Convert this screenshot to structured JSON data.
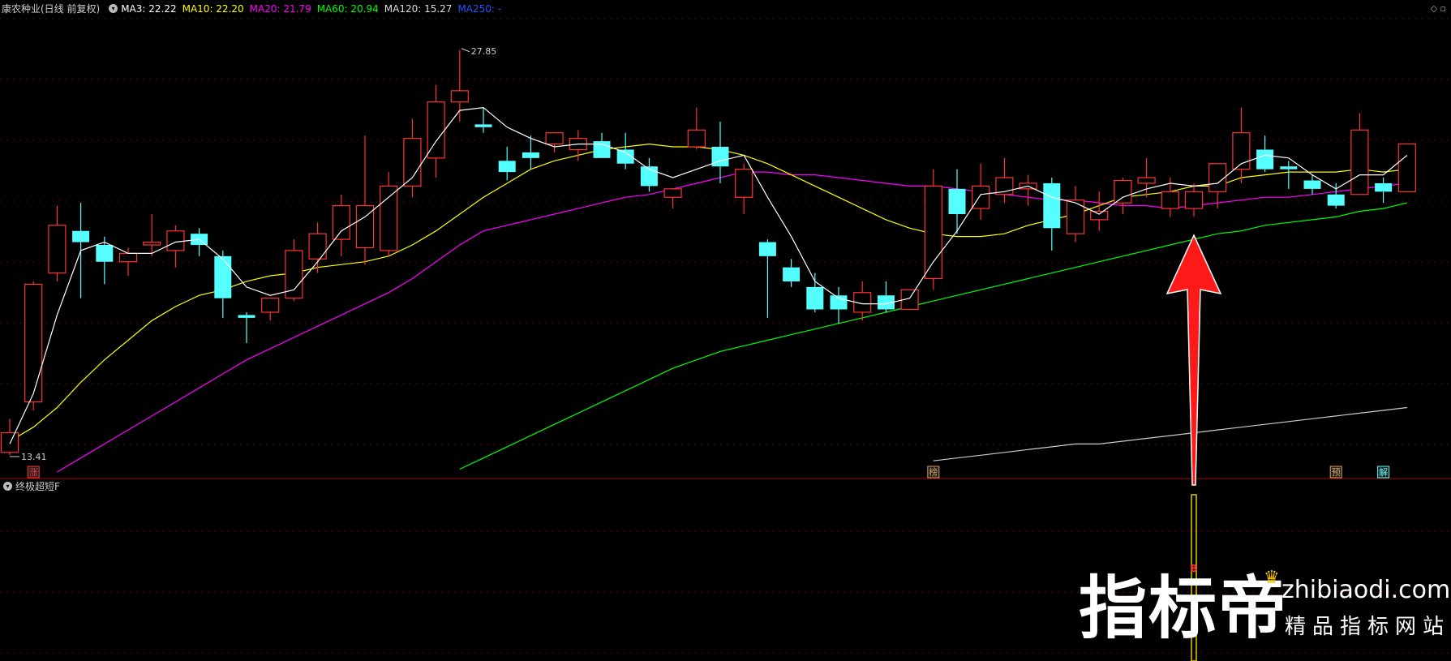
{
  "header": {
    "stock_name": "康农种业(日线 前复权)",
    "ma3": "MA3: 22.22",
    "ma10": "MA10: 22.20",
    "ma20": "MA20: 21.79",
    "ma60": "MA60: 20.94",
    "ma120": "MA120: 15.27",
    "ma250": "MA250: -"
  },
  "sub_panel": {
    "title": "终极超短F"
  },
  "watermark": {
    "brand": "指标帝",
    "url": "zhibiaodi.com",
    "tagline": "精品指标网站"
  },
  "colors": {
    "up": "#ff3333",
    "down": "#54ffff",
    "ma3": "#ffffff",
    "ma10": "#ffff00",
    "ma20": "#ff00ff",
    "ma60": "#00ff00",
    "ma120": "#cccccc",
    "arrow": "#ff1a1a",
    "signal": "#e6c800"
  },
  "chart_data": {
    "type": "candlestick",
    "ylim": [
      12.8,
      29.0
    ],
    "candles": [
      [
        13.5,
        14.7,
        13.41,
        14.2
      ],
      [
        15.3,
        19.6,
        15.0,
        19.5
      ],
      [
        19.9,
        22.3,
        19.6,
        21.6
      ],
      [
        21.4,
        22.4,
        19.0,
        21.0
      ],
      [
        20.9,
        21.2,
        19.5,
        20.3
      ],
      [
        20.3,
        20.8,
        19.8,
        20.6
      ],
      [
        20.9,
        22.0,
        20.5,
        21.0
      ],
      [
        20.7,
        21.6,
        20.1,
        21.4
      ],
      [
        21.3,
        21.5,
        20.5,
        20.9
      ],
      [
        20.5,
        20.7,
        18.3,
        19.0
      ],
      [
        18.4,
        18.5,
        17.4,
        18.3
      ],
      [
        18.5,
        19.0,
        18.2,
        19.0
      ],
      [
        19.0,
        21.1,
        18.9,
        20.7
      ],
      [
        20.4,
        21.7,
        19.9,
        21.3
      ],
      [
        21.1,
        22.7,
        20.5,
        22.3
      ],
      [
        20.8,
        24.8,
        20.2,
        22.3
      ],
      [
        20.7,
        23.5,
        20.5,
        23.0
      ],
      [
        23.0,
        25.4,
        22.6,
        24.7
      ],
      [
        24.0,
        26.6,
        23.3,
        26.0
      ],
      [
        26.0,
        27.85,
        25.3,
        26.4
      ],
      [
        25.2,
        25.8,
        24.9,
        25.1
      ],
      [
        23.9,
        24.4,
        23.2,
        23.5
      ],
      [
        24.2,
        24.8,
        23.6,
        24.0
      ],
      [
        24.5,
        24.9,
        24.2,
        24.9
      ],
      [
        24.3,
        25.0,
        23.9,
        24.7
      ],
      [
        24.6,
        24.9,
        24.0,
        24.0
      ],
      [
        24.3,
        24.9,
        23.6,
        23.8
      ],
      [
        23.7,
        24.0,
        22.8,
        23.0
      ],
      [
        22.6,
        22.8,
        22.2,
        22.9
      ],
      [
        24.4,
        25.8,
        24.3,
        25.0
      ],
      [
        24.4,
        25.3,
        23.1,
        23.7
      ],
      [
        22.6,
        23.8,
        22.0,
        23.6
      ],
      [
        21.0,
        21.1,
        18.3,
        20.5
      ],
      [
        20.1,
        20.4,
        19.4,
        19.6
      ],
      [
        19.4,
        19.9,
        18.5,
        18.6
      ],
      [
        19.1,
        19.4,
        18.1,
        18.6
      ],
      [
        18.5,
        19.6,
        18.2,
        19.2
      ],
      [
        19.1,
        19.6,
        18.5,
        18.6
      ],
      [
        18.6,
        19.3,
        18.6,
        19.3
      ],
      [
        19.7,
        23.6,
        19.3,
        23.0
      ],
      [
        22.9,
        23.6,
        21.3,
        22.0
      ],
      [
        22.2,
        23.8,
        21.8,
        23.0
      ],
      [
        22.7,
        24.0,
        22.4,
        23.3
      ],
      [
        22.9,
        23.4,
        22.3,
        23.1
      ],
      [
        23.1,
        23.3,
        20.7,
        21.5
      ],
      [
        21.3,
        23.0,
        21.0,
        22.5
      ],
      [
        21.8,
        22.8,
        21.4,
        22.1
      ],
      [
        22.4,
        23.3,
        22.0,
        23.2
      ],
      [
        23.1,
        24.0,
        22.6,
        23.3
      ],
      [
        22.2,
        23.3,
        21.9,
        22.8
      ],
      [
        22.2,
        23.1,
        21.9,
        22.8
      ],
      [
        22.8,
        23.8,
        22.2,
        23.8
      ],
      [
        23.6,
        25.8,
        23.1,
        24.9
      ],
      [
        24.3,
        24.8,
        23.5,
        23.6
      ],
      [
        23.7,
        23.9,
        22.9,
        23.6
      ],
      [
        23.2,
        23.4,
        22.7,
        22.9
      ],
      [
        22.7,
        23.1,
        22.2,
        22.3
      ],
      [
        22.7,
        25.6,
        22.7,
        25.0
      ],
      [
        23.1,
        23.3,
        22.4,
        22.8
      ],
      [
        22.8,
        24.5,
        22.8,
        24.5
      ]
    ],
    "ma3": [
      13.8,
      15.6,
      18.4,
      20.7,
      21.0,
      20.6,
      20.6,
      21.0,
      21.1,
      20.4,
      19.4,
      19.1,
      19.3,
      20.3,
      21.4,
      21.9,
      22.6,
      23.3,
      24.6,
      25.7,
      25.8,
      25.1,
      24.7,
      24.4,
      24.5,
      24.5,
      24.2,
      23.6,
      23.3,
      23.6,
      23.9,
      24.1,
      22.6,
      21.2,
      19.6,
      19.0,
      18.8,
      18.8,
      19.0,
      20.3,
      21.4,
      22.7,
      22.8,
      23.0,
      22.6,
      22.4,
      22.0,
      22.6,
      22.9,
      23.1,
      23.0,
      23.1,
      23.8,
      24.1,
      24.0,
      23.4,
      22.9,
      23.4,
      23.4,
      24.1
    ],
    "ma10": [
      13.9,
      14.4,
      15.1,
      16.0,
      16.8,
      17.5,
      18.2,
      18.7,
      19.1,
      19.3,
      19.6,
      19.8,
      19.9,
      20.1,
      20.2,
      20.3,
      20.5,
      20.9,
      21.4,
      22.0,
      22.6,
      23.1,
      23.6,
      23.9,
      24.1,
      24.3,
      24.4,
      24.5,
      24.4,
      24.4,
      24.3,
      24.1,
      23.8,
      23.4,
      23.0,
      22.6,
      22.2,
      21.8,
      21.5,
      21.3,
      21.2,
      21.2,
      21.3,
      21.6,
      21.8,
      22.0,
      22.3,
      22.6,
      22.7,
      22.8,
      23.0,
      23.0,
      23.3,
      23.4,
      23.5,
      23.5,
      23.5,
      23.6,
      23.5,
      23.6
    ],
    "ma20": [
      null,
      null,
      12.8,
      13.3,
      13.8,
      14.3,
      14.8,
      15.3,
      15.8,
      16.3,
      16.8,
      17.2,
      17.6,
      18.0,
      18.4,
      18.8,
      19.2,
      19.7,
      20.3,
      20.9,
      21.4,
      21.6,
      21.8,
      22.0,
      22.2,
      22.4,
      22.6,
      22.7,
      22.9,
      23.1,
      23.3,
      23.5,
      23.5,
      23.4,
      23.4,
      23.3,
      23.2,
      23.1,
      23.0,
      23.0,
      22.9,
      22.8,
      22.7,
      22.6,
      22.5,
      22.5,
      22.4,
      22.3,
      22.3,
      22.2,
      22.3,
      22.4,
      22.5,
      22.6,
      22.6,
      22.7,
      22.8,
      22.9,
      23.0,
      23.1
    ],
    "ma60": [
      null,
      null,
      null,
      null,
      null,
      null,
      null,
      null,
      null,
      null,
      null,
      null,
      null,
      null,
      null,
      null,
      null,
      null,
      null,
      12.9,
      13.3,
      13.7,
      14.1,
      14.5,
      14.9,
      15.3,
      15.7,
      16.1,
      16.5,
      16.8,
      17.1,
      17.3,
      17.5,
      17.7,
      17.9,
      18.1,
      18.3,
      18.5,
      18.7,
      18.9,
      19.1,
      19.3,
      19.5,
      19.7,
      19.9,
      20.1,
      20.3,
      20.5,
      20.7,
      20.9,
      21.1,
      21.3,
      21.4,
      21.6,
      21.7,
      21.8,
      21.9,
      22.1,
      22.2,
      22.4
    ],
    "ma120": [
      null,
      null,
      null,
      null,
      null,
      null,
      null,
      null,
      null,
      null,
      null,
      null,
      null,
      null,
      null,
      null,
      null,
      null,
      null,
      null,
      null,
      null,
      null,
      null,
      null,
      null,
      null,
      null,
      null,
      null,
      null,
      null,
      null,
      null,
      null,
      null,
      null,
      null,
      null,
      13.2,
      13.3,
      13.4,
      13.5,
      13.6,
      13.7,
      13.8,
      13.8,
      13.9,
      14.0,
      14.1,
      14.2,
      14.3,
      14.4,
      14.5,
      14.6,
      14.7,
      14.8,
      14.9,
      15.0,
      15.1
    ],
    "high_label": "27.85",
    "low_label": "13.41",
    "markers": [
      {
        "index": 1,
        "label": "涨",
        "color": "#ff3333"
      },
      {
        "index": 39,
        "label": "榜",
        "color": "#d4a060"
      },
      {
        "index": 56,
        "label": "预",
        "color": "#d4a060"
      },
      {
        "index": 58,
        "label": "解",
        "color": "#54ffff"
      }
    ],
    "signal_index": 50,
    "signal_label": "B"
  }
}
